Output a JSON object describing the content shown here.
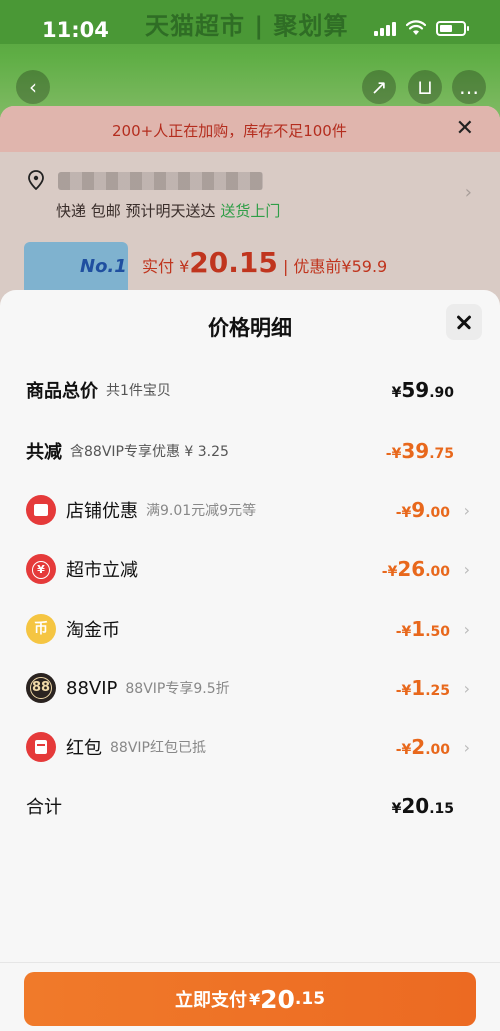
{
  "status_bar": {
    "time": "11:04"
  },
  "background": {
    "banner_text": "天猫超市 | 聚划算",
    "alert_text": "200+人正在加购，库存不足100件",
    "shipping_text": "快递 包邮 预计明天送达",
    "shipping_link": "送货上门",
    "thumb_label": "No.1",
    "price_prefix": "实付 ¥",
    "price_value": "20.15",
    "price_before": "| 优惠前¥59.9"
  },
  "modal": {
    "title": "价格明细",
    "rows": [
      {
        "label": "商品总价",
        "note": "共1件宝贝",
        "currency": "¥",
        "int": "59",
        "dec": ".90"
      },
      {
        "label": "共减",
        "note": "含88VIP专享优惠 ¥ 3.25",
        "currency": "-¥",
        "int": "39",
        "dec": ".75"
      },
      {
        "label": "店铺优惠",
        "note": "满9.01元减9元等",
        "icon": "shop-icon",
        "currency": "-¥",
        "int": "9",
        "dec": ".00"
      },
      {
        "label": "超市立减",
        "note": "",
        "icon": "yen-icon",
        "currency": "-¥",
        "int": "26",
        "dec": ".00"
      },
      {
        "label": "淘金币",
        "note": "",
        "icon": "coin-icon",
        "currency": "-¥",
        "int": "1",
        "dec": ".50"
      },
      {
        "label": "88VIP",
        "note": "88VIP专享9.5折",
        "icon": "vip88-icon",
        "currency": "-¥",
        "int": "1",
        "dec": ".25"
      },
      {
        "label": "红包",
        "note": "88VIP红包已抵",
        "icon": "red-packet-icon",
        "currency": "-¥",
        "int": "2",
        "dec": ".00"
      },
      {
        "label": "合计",
        "note": "",
        "currency": "¥",
        "int": "20",
        "dec": ".15"
      }
    ]
  },
  "pay_button": {
    "label": "立即支付",
    "currency": "¥",
    "int": "20",
    "dec": ".15"
  },
  "icons": {
    "coin_glyph": "币",
    "yen_glyph": "¥",
    "vip_glyph": "88"
  },
  "colors": {
    "accent": "#ec6a22",
    "discount": "#e8681c",
    "alert": "#b42d1e",
    "green": "#2f9e47"
  }
}
